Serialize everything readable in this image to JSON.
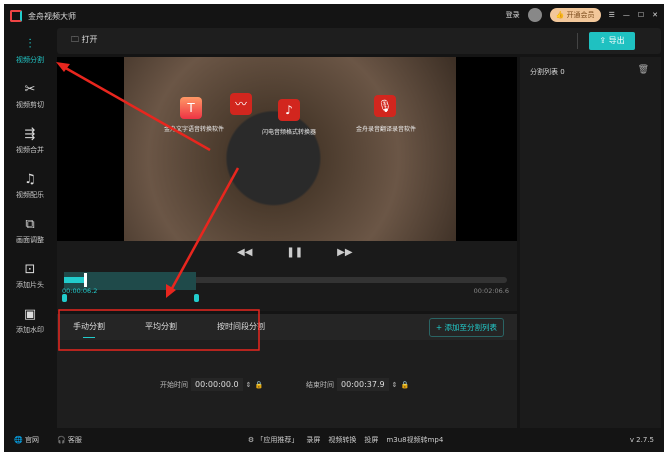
{
  "app": {
    "title": "金舟视频大师",
    "login": "登录",
    "vip": "开通会员"
  },
  "sidebar": [
    {
      "label": "视频分割",
      "icon": "split-icon"
    },
    {
      "label": "视频剪切",
      "icon": "scissors-icon"
    },
    {
      "label": "视频合并",
      "icon": "merge-icon"
    },
    {
      "label": "视频配乐",
      "icon": "music-icon"
    },
    {
      "label": "画面调整",
      "icon": "crop-icon"
    },
    {
      "label": "添加片头",
      "icon": "add-intro-icon"
    },
    {
      "label": "添加水印",
      "icon": "watermark-icon"
    }
  ],
  "toolbar": {
    "open": "打开",
    "export": "导出"
  },
  "video": {
    "apps": [
      "金舟文字语音转换软件",
      "闪电音频格式转换器",
      "金舟录音翻译录音软件"
    ]
  },
  "player": {
    "current": "00:00:06.2",
    "total": "00:02:06.6",
    "progress": 0.05
  },
  "tabs": [
    "手动分割",
    "平均分割",
    "按时间段分割"
  ],
  "add_to_list": "+ 添加至分割列表",
  "start": {
    "label": "开始时间",
    "h": "00",
    "m": "00",
    "s": "00.0"
  },
  "end": {
    "label": "结束时间",
    "h": "00",
    "m": "00",
    "s": "37.9"
  },
  "split_list": {
    "title": "分割列表 0"
  },
  "footer": {
    "website": "官网",
    "service": "客服",
    "recommend": "「应用推荐」",
    "links": [
      "录屏",
      "视频转换",
      "投屏",
      "m3u8视频转mp4"
    ],
    "version": "v 2.7.5"
  }
}
